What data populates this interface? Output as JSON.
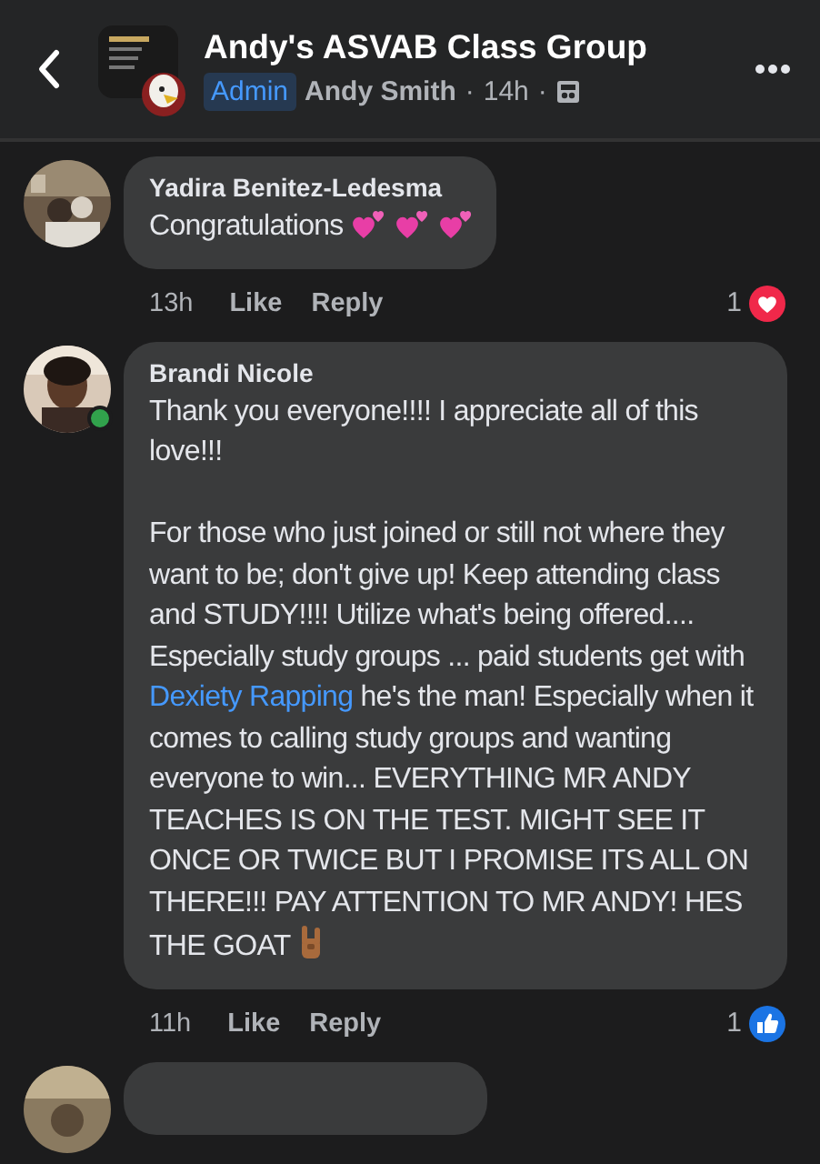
{
  "header": {
    "title": "Andy's ASVAB Class Group",
    "badge": "Admin",
    "author": "Andy Smith",
    "time": "14h",
    "separator": "·"
  },
  "comments": [
    {
      "author": "Yadira Benitez-Ledesma",
      "online": false,
      "paragraphs": [
        [
          {
            "text": "Congratulations",
            "link": false
          }
        ]
      ],
      "kind": "hearts",
      "time": "13h",
      "actions": [
        "Like",
        "Reply"
      ],
      "reaction": {
        "kind": "love",
        "count": "1"
      }
    },
    {
      "author": "Brandi Nicole",
      "online": true,
      "paragraphs": [
        [
          {
            "text": "Thank you everyone!!!! I appreciate all of this love!!!",
            "link": false
          }
        ],
        [
          {
            "text": "For those who just joined or still not where they want to be; don't give up! Keep attending class and STUDY!!!! Utilize what's being offered.... Especially study groups ... paid students get with ",
            "link": false
          },
          {
            "text": "Dexiety Rapping",
            "link": true
          },
          {
            "text": " he's the man! Especially when it comes to calling study groups and wanting everyone to win... EVERYTHING MR ANDY TEACHES IS ON THE TEST. MIGHT SEE IT ONCE OR TWICE BUT I PROMISE ITS ALL ON THERE!!! PAY ATTENTION TO MR ANDY! HES THE GOAT",
            "link": false
          }
        ]
      ],
      "kind": "horns",
      "time": "11h",
      "actions": [
        "Like",
        "Reply"
      ],
      "reaction": {
        "kind": "like",
        "count": "1"
      }
    }
  ]
}
